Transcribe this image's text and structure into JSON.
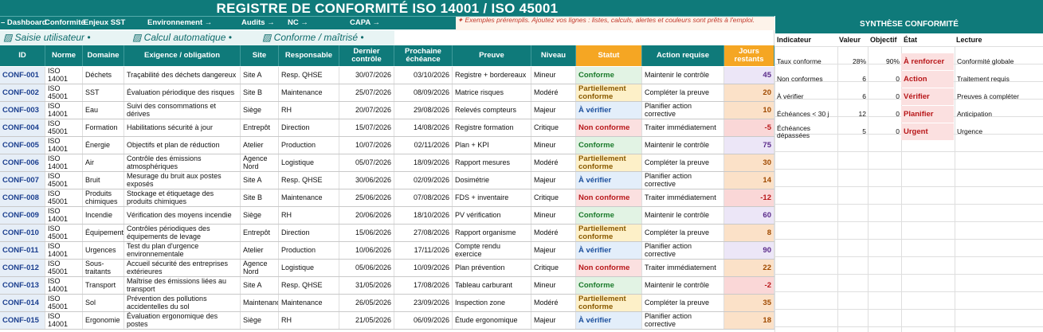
{
  "title": "REGISTRE DE CONFORMITÉ ISO 14001 / ISO 45001",
  "nav": [
    "– Dashboard",
    "Conformité",
    "Enjeux SST",
    "Environnement →",
    "Audits →",
    "NC →",
    "CAPA →"
  ],
  "legend": {
    "input": "▨ Saisie utilisateur  •",
    "calc": "▨ Calcul automatique  •",
    "ok": "▨ Conforme / maîtrisé  •"
  },
  "note": "✦ Exemples préremplis. Ajoutez vos lignes : listes, calculs, alertes et couleurs sont prêts à l'emploi.",
  "headers": [
    "ID",
    "Norme",
    "Domaine",
    "Exigence / obligation",
    "Site",
    "Responsable",
    "Dernier contrôle",
    "Prochaine échéance",
    "Preuve",
    "Niveau",
    "Statut",
    "Action requise",
    "Jours restants"
  ],
  "rows": [
    {
      "id": "CONF-001",
      "norme": "ISO 14001",
      "domaine": "Déchets",
      "exigence": "Traçabilité des déchets dangereux",
      "site": "Site A",
      "resp": "Resp. QHSE",
      "dernier": "30/07/2026",
      "prochaine": "03/10/2026",
      "preuve": "Registre + bordereaux",
      "niveau": "Mineur",
      "statut": "Conforme",
      "action": "Maintenir le contrôle",
      "jours": "45"
    },
    {
      "id": "CONF-002",
      "norme": "ISO 45001",
      "domaine": "SST",
      "exigence": "Évaluation périodique des risques",
      "site": "Site B",
      "resp": "Maintenance",
      "dernier": "25/07/2026",
      "prochaine": "08/09/2026",
      "preuve": "Matrice risques",
      "niveau": "Modéré",
      "statut": "Partiellement conforme",
      "action": "Compléter la preuve",
      "jours": "20"
    },
    {
      "id": "CONF-003",
      "norme": "ISO 14001",
      "domaine": "Eau",
      "exigence": "Suivi des consommations et dérives",
      "site": "Siège",
      "resp": "RH",
      "dernier": "20/07/2026",
      "prochaine": "29/08/2026",
      "preuve": "Relevés compteurs",
      "niveau": "Majeur",
      "statut": "À vérifier",
      "action": "Planifier action corrective",
      "jours": "10"
    },
    {
      "id": "CONF-004",
      "norme": "ISO 45001",
      "domaine": "Formation",
      "exigence": "Habilitations sécurité à jour",
      "site": "Entrepôt",
      "resp": "Direction",
      "dernier": "15/07/2026",
      "prochaine": "14/08/2026",
      "preuve": "Registre formation",
      "niveau": "Critique",
      "statut": "Non conforme",
      "action": "Traiter immédiatement",
      "jours": "-5"
    },
    {
      "id": "CONF-005",
      "norme": "ISO 14001",
      "domaine": "Énergie",
      "exigence": "Objectifs et plan de réduction",
      "site": "Atelier",
      "resp": "Production",
      "dernier": "10/07/2026",
      "prochaine": "02/11/2026",
      "preuve": "Plan + KPI",
      "niveau": "Mineur",
      "statut": "Conforme",
      "action": "Maintenir le contrôle",
      "jours": "75"
    },
    {
      "id": "CONF-006",
      "norme": "ISO 14001",
      "domaine": "Air",
      "exigence": "Contrôle des émissions atmosphériques",
      "site": "Agence Nord",
      "resp": "Logistique",
      "dernier": "05/07/2026",
      "prochaine": "18/09/2026",
      "preuve": "Rapport mesures",
      "niveau": "Modéré",
      "statut": "Partiellement conforme",
      "action": "Compléter la preuve",
      "jours": "30"
    },
    {
      "id": "CONF-007",
      "norme": "ISO 45001",
      "domaine": "Bruit",
      "exigence": "Mesurage du bruit aux postes exposés",
      "site": "Site A",
      "resp": "Resp. QHSE",
      "dernier": "30/06/2026",
      "prochaine": "02/09/2026",
      "preuve": "Dosimétrie",
      "niveau": "Majeur",
      "statut": "À vérifier",
      "action": "Planifier action corrective",
      "jours": "14"
    },
    {
      "id": "CONF-008",
      "norme": "ISO 45001",
      "domaine": "Produits chimiques",
      "exigence": "Stockage et étiquetage des produits chimiques",
      "site": "Site B",
      "resp": "Maintenance",
      "dernier": "25/06/2026",
      "prochaine": "07/08/2026",
      "preuve": "FDS + inventaire",
      "niveau": "Critique",
      "statut": "Non conforme",
      "action": "Traiter immédiatement",
      "jours": "-12"
    },
    {
      "id": "CONF-009",
      "norme": "ISO 14001",
      "domaine": "Incendie",
      "exigence": "Vérification des moyens incendie",
      "site": "Siège",
      "resp": "RH",
      "dernier": "20/06/2026",
      "prochaine": "18/10/2026",
      "preuve": "PV vérification",
      "niveau": "Mineur",
      "statut": "Conforme",
      "action": "Maintenir le contrôle",
      "jours": "60"
    },
    {
      "id": "CONF-010",
      "norme": "ISO 45001",
      "domaine": "Équipements",
      "exigence": "Contrôles périodiques des équipements de levage",
      "site": "Entrepôt",
      "resp": "Direction",
      "dernier": "15/06/2026",
      "prochaine": "27/08/2026",
      "preuve": "Rapport organisme",
      "niveau": "Modéré",
      "statut": "Partiellement conforme",
      "action": "Compléter la preuve",
      "jours": "8"
    },
    {
      "id": "CONF-011",
      "norme": "ISO 14001",
      "domaine": "Urgences",
      "exigence": "Test du plan d'urgence environnementale",
      "site": "Atelier",
      "resp": "Production",
      "dernier": "10/06/2026",
      "prochaine": "17/11/2026",
      "preuve": "Compte rendu exercice",
      "niveau": "Majeur",
      "statut": "À vérifier",
      "action": "Planifier action corrective",
      "jours": "90"
    },
    {
      "id": "CONF-012",
      "norme": "ISO 45001",
      "domaine": "Sous-traitants",
      "exigence": "Accueil sécurité des entreprises extérieures",
      "site": "Agence Nord",
      "resp": "Logistique",
      "dernier": "05/06/2026",
      "prochaine": "10/09/2026",
      "preuve": "Plan prévention",
      "niveau": "Critique",
      "statut": "Non conforme",
      "action": "Traiter immédiatement",
      "jours": "22"
    },
    {
      "id": "CONF-013",
      "norme": "ISO 14001",
      "domaine": "Transport",
      "exigence": "Maîtrise des émissions liées au transport",
      "site": "Site A",
      "resp": "Resp. QHSE",
      "dernier": "31/05/2026",
      "prochaine": "17/08/2026",
      "preuve": "Tableau carburant",
      "niveau": "Mineur",
      "statut": "Conforme",
      "action": "Maintenir le contrôle",
      "jours": "-2"
    },
    {
      "id": "CONF-014",
      "norme": "ISO 45001",
      "domaine": "Sol",
      "exigence": "Prévention des pollutions accidentelles du sol",
      "site": "Maintenance",
      "resp": "Maintenance",
      "dernier": "26/05/2026",
      "prochaine": "23/09/2026",
      "preuve": "Inspection zone",
      "niveau": "Modéré",
      "statut": "Partiellement conforme",
      "action": "Compléter la preuve",
      "jours": "35"
    },
    {
      "id": "CONF-015",
      "norme": "ISO 14001",
      "domaine": "Ergonomie",
      "exigence": "Évaluation ergonomique des postes",
      "site": "Siège",
      "resp": "RH",
      "dernier": "21/05/2026",
      "prochaine": "06/09/2026",
      "preuve": "Étude ergonomique",
      "niveau": "Majeur",
      "statut": "À vérifier",
      "action": "Planifier action corrective",
      "jours": "18"
    }
  ],
  "summary": {
    "title": "SYNTHÈSE CONFORMITÉ",
    "headers": [
      "Indicateur",
      "Valeur",
      "Objectif",
      "État",
      "Lecture"
    ],
    "rows": [
      {
        "ind": "Taux conforme",
        "val": "28%",
        "obj": "90%",
        "etat": "À renforcer",
        "lecture": "Conformité globale"
      },
      {
        "ind": "Non conformes",
        "val": "6",
        "obj": "0",
        "etat": "Action",
        "lecture": "Traitement requis"
      },
      {
        "ind": "À vérifier",
        "val": "6",
        "obj": "0",
        "etat": "Vérifier",
        "lecture": "Preuves à compléter"
      },
      {
        "ind": "Échéances < 30 j",
        "val": "12",
        "obj": "0",
        "etat": "Planifier",
        "lecture": "Anticipation"
      },
      {
        "ind": "Échéances dépassées",
        "val": "5",
        "obj": "0",
        "etat": "Urgent",
        "lecture": "Urgence"
      }
    ]
  },
  "colors": {
    "accent": "#0f7a7a",
    "status_header": "#f5a623"
  }
}
